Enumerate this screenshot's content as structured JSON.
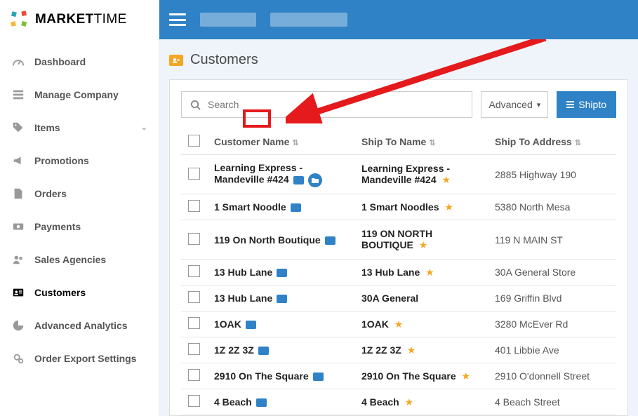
{
  "logo": {
    "bold": "MARKET",
    "light": "TIME"
  },
  "sidebar": [
    {
      "label": "Dashboard",
      "icon": "speedometer-icon",
      "chev": false,
      "active": false
    },
    {
      "label": "Manage Company",
      "icon": "list-icon",
      "chev": false,
      "active": false
    },
    {
      "label": "Items",
      "icon": "tags-icon",
      "chev": true,
      "active": false
    },
    {
      "label": "Promotions",
      "icon": "megaphone-icon",
      "chev": false,
      "active": false
    },
    {
      "label": "Orders",
      "icon": "document-icon",
      "chev": false,
      "active": false
    },
    {
      "label": "Payments",
      "icon": "money-icon",
      "chev": false,
      "active": false
    },
    {
      "label": "Sales Agencies",
      "icon": "people-icon",
      "chev": false,
      "active": false
    },
    {
      "label": "Customers",
      "icon": "id-card-icon",
      "chev": false,
      "active": true
    },
    {
      "label": "Advanced Analytics",
      "icon": "piechart-icon",
      "chev": false,
      "active": false
    },
    {
      "label": "Order Export Settings",
      "icon": "gears-icon",
      "chev": false,
      "active": false
    }
  ],
  "page": {
    "title": "Customers"
  },
  "search": {
    "placeholder": "Search"
  },
  "buttons": {
    "advanced": "Advanced",
    "shipto": "Shipto"
  },
  "columns": {
    "customer": "Customer Name",
    "shipTo": "Ship To Name",
    "addr": "Ship To Address"
  },
  "rows": [
    {
      "tall": true,
      "cname": "Learning Express - Mandeville #424",
      "folder": true,
      "sname": "Learning Express - Mandeville #424",
      "star": true,
      "addr": "2885 Highway 190"
    },
    {
      "tall": false,
      "cname": "1 Smart Noodle",
      "folder": false,
      "sname": "1 Smart Noodles",
      "star": true,
      "addr": "5380 North Mesa"
    },
    {
      "tall": true,
      "cname": "119 On North Boutique",
      "folder": false,
      "sname": "119 ON NORTH BOUTIQUE",
      "star": true,
      "addr": "119 N MAIN ST"
    },
    {
      "tall": false,
      "cname": "13 Hub Lane",
      "folder": false,
      "sname": "13 Hub Lane",
      "star": true,
      "addr": "30A General Store"
    },
    {
      "tall": false,
      "cname": "13 Hub Lane",
      "folder": false,
      "sname": "30A General",
      "star": false,
      "addr": "169 Griffin Blvd"
    },
    {
      "tall": false,
      "cname": "1OAK",
      "folder": false,
      "sname": "1OAK",
      "star": true,
      "addr": "3280 McEver Rd"
    },
    {
      "tall": false,
      "cname": "1Z 2Z 3Z",
      "folder": false,
      "sname": "1Z 2Z 3Z",
      "star": true,
      "addr": "401 Libbie Ave"
    },
    {
      "tall": false,
      "cname": "2910 On The Square",
      "folder": false,
      "sname": "2910 On The Square",
      "star": true,
      "addr": "2910 O'donnell Street"
    },
    {
      "tall": false,
      "cname": "4 Beach",
      "folder": false,
      "sname": "4 Beach",
      "star": true,
      "addr": "4 Beach Street"
    }
  ]
}
